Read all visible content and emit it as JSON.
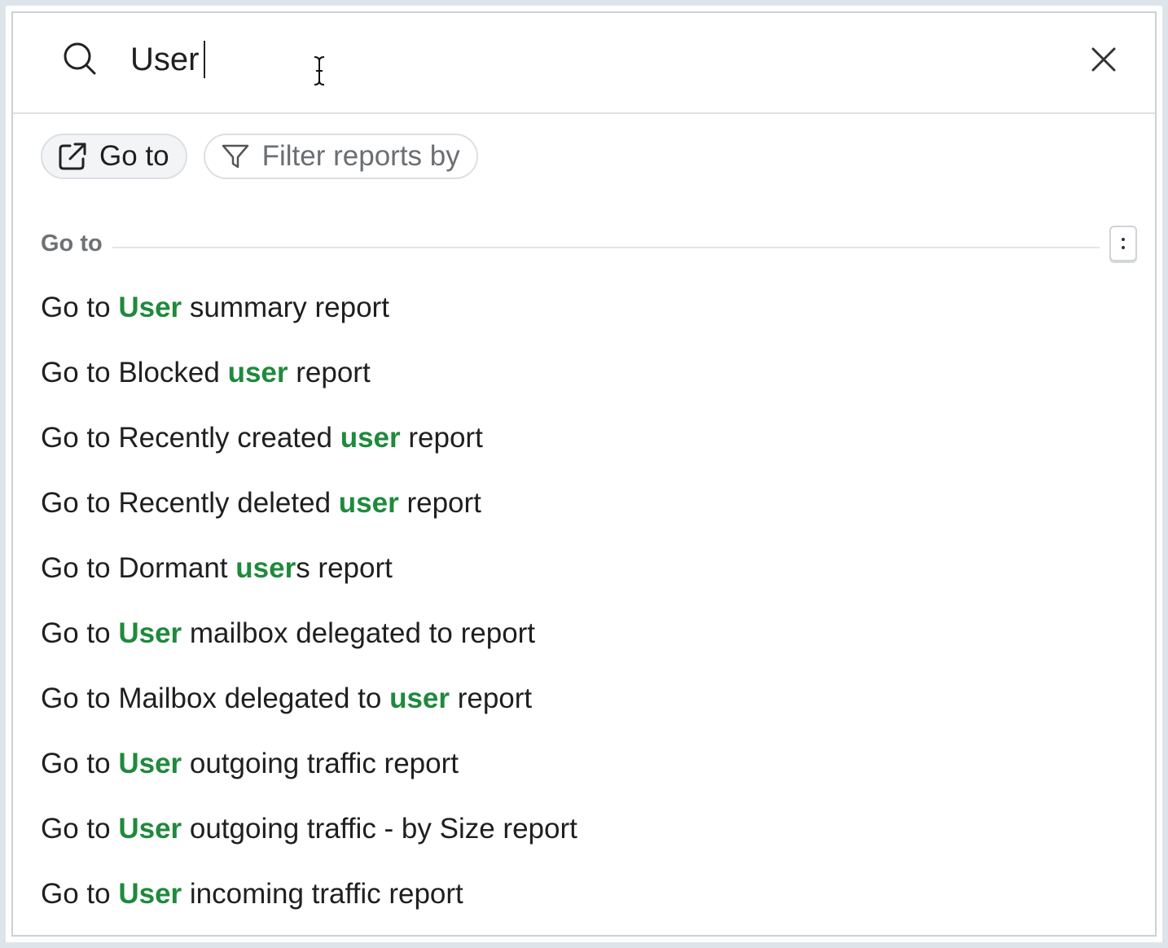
{
  "search": {
    "query": "User"
  },
  "chips": [
    {
      "label": "Go to",
      "icon": "external-link-icon",
      "active": true
    },
    {
      "label": "Filter reports by",
      "icon": "filter-icon",
      "active": false
    }
  ],
  "section": {
    "title": "Go to",
    "more_icon": "vertical-ellipsis-icon"
  },
  "colors": {
    "highlight": "#1f8a3c",
    "border": "#c9d1d8"
  },
  "results": [
    {
      "pre": "Go to ",
      "match": "User",
      "post": " summary report"
    },
    {
      "pre": "Go to Blocked ",
      "match": "user",
      "post": " report"
    },
    {
      "pre": "Go to Recently created ",
      "match": "user",
      "post": " report"
    },
    {
      "pre": "Go to Recently deleted ",
      "match": "user",
      "post": " report"
    },
    {
      "pre": "Go to Dormant ",
      "match": "user",
      "post": "s report"
    },
    {
      "pre": "Go to ",
      "match": "User",
      "post": " mailbox delegated to report"
    },
    {
      "pre": "Go to Mailbox delegated to ",
      "match": "user",
      "post": " report"
    },
    {
      "pre": "Go to ",
      "match": "User",
      "post": " outgoing traffic report"
    },
    {
      "pre": "Go to ",
      "match": "User",
      "post": " outgoing traffic - by Size report"
    },
    {
      "pre": "Go to ",
      "match": "User",
      "post": " incoming traffic report"
    }
  ]
}
